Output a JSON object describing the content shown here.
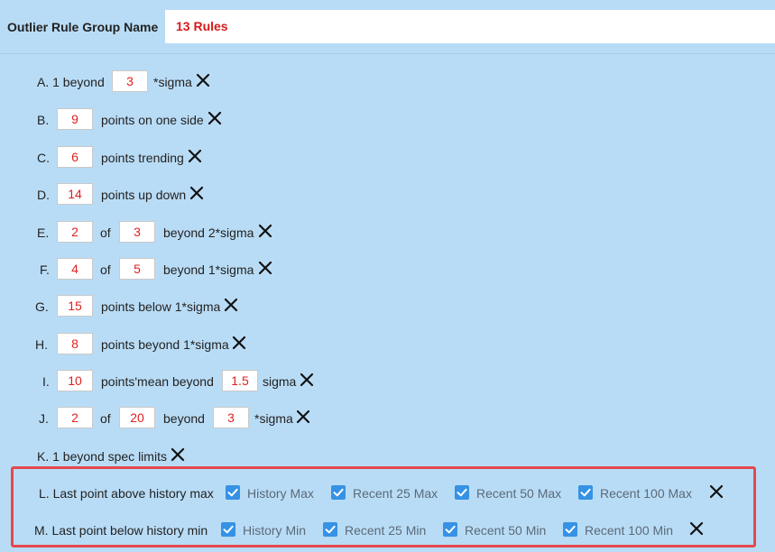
{
  "header": {
    "label": "Outlier Rule Group Name",
    "value": "13 Rules"
  },
  "rules": {
    "a": {
      "prefix": "A. 1 beyond",
      "value": "3",
      "suffix": "*sigma"
    },
    "b": {
      "prefix": "B.",
      "value": "9",
      "suffix": "points on one side"
    },
    "c": {
      "prefix": "C.",
      "value": "6",
      "suffix": "points trending"
    },
    "d": {
      "prefix": "D.",
      "value": "14",
      "suffix": "points up down"
    },
    "e": {
      "prefix": "E.",
      "value1": "2",
      "mid": "of",
      "value2": "3",
      "suffix": "beyond 2*sigma"
    },
    "f": {
      "prefix": "F.",
      "value1": "4",
      "mid": "of",
      "value2": "5",
      "suffix": "beyond 1*sigma"
    },
    "g": {
      "prefix": "G.",
      "value": "15",
      "suffix": "points below 1*sigma"
    },
    "h": {
      "prefix": "H.",
      "value": "8",
      "suffix": "points beyond 1*sigma"
    },
    "i": {
      "prefix": "I.",
      "value1": "10",
      "mid": "points'mean beyond",
      "value2": "1.5",
      "suffix": "sigma"
    },
    "j": {
      "prefix": "J.",
      "value1": "2",
      "mid1": "of",
      "value2": "20",
      "mid2": "beyond",
      "value3": "3",
      "suffix": "*sigma"
    },
    "k": {
      "label": "K. 1 beyond spec limits"
    },
    "l": {
      "label": "L. Last point above history max",
      "options": [
        {
          "label": "History Max",
          "checked": true
        },
        {
          "label": "Recent 25 Max",
          "checked": true
        },
        {
          "label": "Recent 50 Max",
          "checked": true
        },
        {
          "label": "Recent 100 Max",
          "checked": true
        }
      ]
    },
    "m": {
      "label": "M. Last point below history min",
      "options": [
        {
          "label": "History Min",
          "checked": true
        },
        {
          "label": "Recent 25 Min",
          "checked": true
        },
        {
          "label": "Recent 50 Min",
          "checked": true
        },
        {
          "label": "Recent 100 Min",
          "checked": true
        }
      ]
    }
  },
  "colors": {
    "background": "#b9dcf6",
    "value_text": "#e02020",
    "checkbox": "#3592e4",
    "highlight_border": "#e5484d"
  },
  "icons": {
    "delete": "close-icon",
    "check": "check-icon"
  }
}
